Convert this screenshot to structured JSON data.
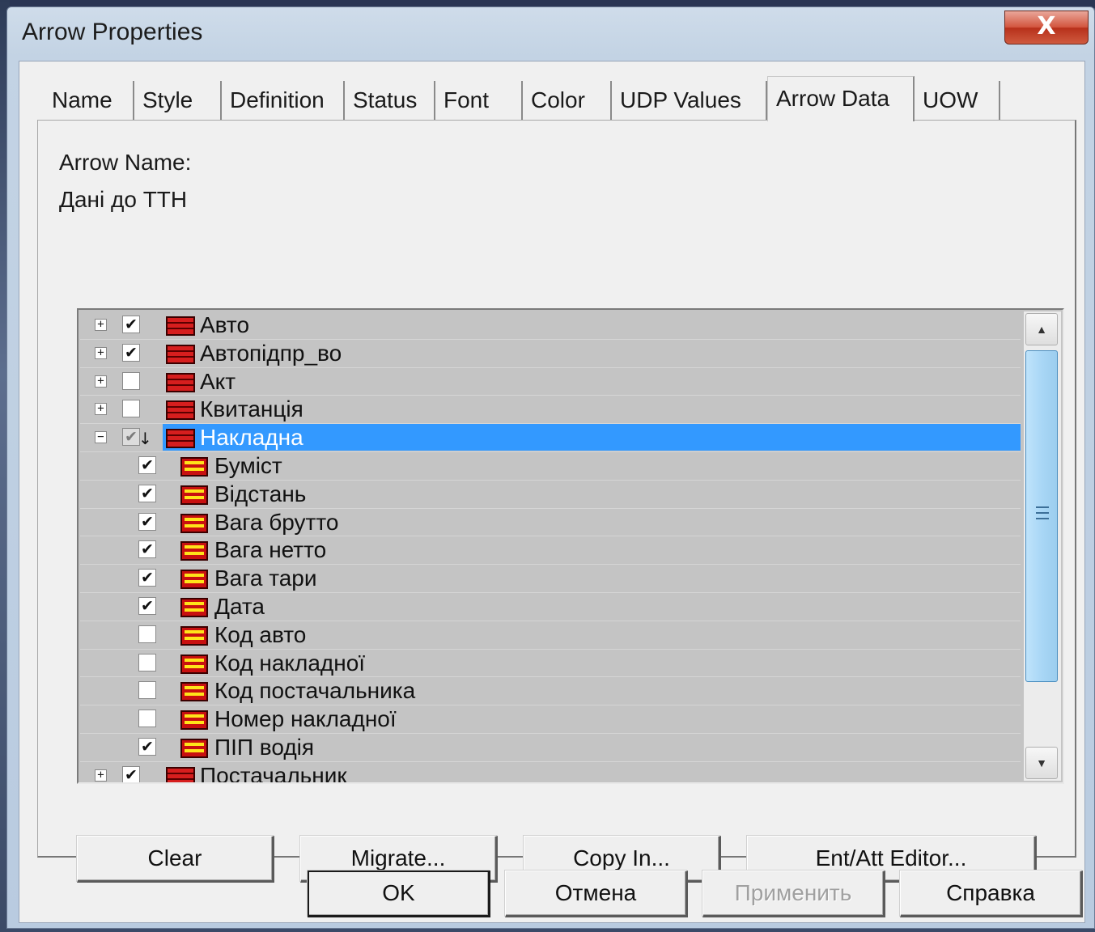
{
  "window": {
    "title": "Arrow Properties",
    "close_glyph": "X"
  },
  "tabs": [
    {
      "label": "Name"
    },
    {
      "label": "Style"
    },
    {
      "label": "Definition"
    },
    {
      "label": "Status"
    },
    {
      "label": "Font"
    },
    {
      "label": "Color"
    },
    {
      "label": "UDP Values"
    },
    {
      "label": "Arrow Data",
      "active": true
    },
    {
      "label": "UOW"
    }
  ],
  "arrow_name": {
    "label": "Arrow Name:",
    "value": "Дані до ТТН"
  },
  "tree": {
    "rows": [
      {
        "label": "Авто",
        "level": 0,
        "expander": "+",
        "checked": true,
        "kind": "entity"
      },
      {
        "label": "Автопідпр_во",
        "level": 0,
        "expander": "+",
        "checked": true,
        "kind": "entity"
      },
      {
        "label": "Акт",
        "level": 0,
        "expander": "+",
        "checked": false,
        "kind": "entity"
      },
      {
        "label": "Квитанція",
        "level": 0,
        "expander": "+",
        "checked": false,
        "kind": "entity"
      },
      {
        "label": "Накладна",
        "level": 0,
        "expander": "−",
        "checked": "partial",
        "kind": "entity",
        "selected": true
      },
      {
        "label": "Буміст",
        "level": 1,
        "checked": true,
        "kind": "attribute"
      },
      {
        "label": "Відстань",
        "level": 1,
        "checked": true,
        "kind": "attribute"
      },
      {
        "label": "Вага брутто",
        "level": 1,
        "checked": true,
        "kind": "attribute"
      },
      {
        "label": "Вага нетто",
        "level": 1,
        "checked": true,
        "kind": "attribute"
      },
      {
        "label": "Вага тари",
        "level": 1,
        "checked": true,
        "kind": "attribute"
      },
      {
        "label": "Дата",
        "level": 1,
        "checked": true,
        "kind": "attribute"
      },
      {
        "label": "Код авто",
        "level": 1,
        "checked": false,
        "kind": "attribute"
      },
      {
        "label": "Код накладної",
        "level": 1,
        "checked": false,
        "kind": "attribute"
      },
      {
        "label": "Код постачальника",
        "level": 1,
        "checked": false,
        "kind": "attribute"
      },
      {
        "label": "Номер накладної",
        "level": 1,
        "checked": false,
        "kind": "attribute"
      },
      {
        "label": "ПІП водія",
        "level": 1,
        "checked": true,
        "kind": "attribute"
      },
      {
        "label": "Постачальник",
        "level": 0,
        "expander": "+",
        "checked": true,
        "kind": "entity"
      }
    ]
  },
  "panel_buttons": {
    "clear": "Clear",
    "migrate": "Migrate...",
    "copy_in": "Copy In...",
    "editor": "Ent/Att Editor..."
  },
  "dialog_buttons": {
    "ok": "OK",
    "cancel": "Отмена",
    "apply": "Применить",
    "help": "Справка"
  },
  "colors": {
    "selection": "#3399ff",
    "tree_background": "#c4c4c4",
    "close_button": "#c8402a"
  }
}
